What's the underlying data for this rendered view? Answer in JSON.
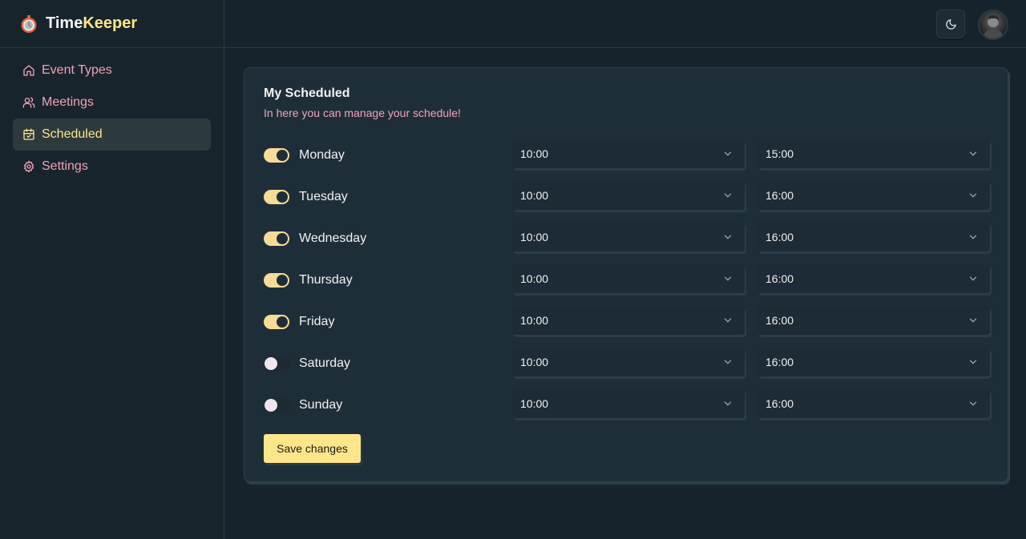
{
  "brand": {
    "name_part1": "Time",
    "name_part2": "Keeper",
    "logo_icon": "stopwatch-icon"
  },
  "nav": {
    "items": [
      {
        "label": "Event Types",
        "icon": "home-icon",
        "active": false
      },
      {
        "label": "Meetings",
        "icon": "users-icon",
        "active": false
      },
      {
        "label": "Scheduled",
        "icon": "calendar-check-icon",
        "active": true
      },
      {
        "label": "Settings",
        "icon": "gear-icon",
        "active": false
      }
    ]
  },
  "header": {
    "theme_icon": "moon-icon",
    "avatar_icon": "user-avatar"
  },
  "card": {
    "title": "My Scheduled",
    "subtitle": "In here you can manage your schedule!",
    "days": [
      {
        "name": "Monday",
        "enabled": true,
        "start": "10:00",
        "end": "15:00"
      },
      {
        "name": "Tuesday",
        "enabled": true,
        "start": "10:00",
        "end": "16:00"
      },
      {
        "name": "Wednesday",
        "enabled": true,
        "start": "10:00",
        "end": "16:00"
      },
      {
        "name": "Thursday",
        "enabled": true,
        "start": "10:00",
        "end": "16:00"
      },
      {
        "name": "Friday",
        "enabled": true,
        "start": "10:00",
        "end": "16:00"
      },
      {
        "name": "Saturday",
        "enabled": false,
        "start": "10:00",
        "end": "16:00"
      },
      {
        "name": "Sunday",
        "enabled": false,
        "start": "10:00",
        "end": "16:00"
      }
    ],
    "save_label": "Save changes"
  },
  "colors": {
    "accent": "#fde68a",
    "pink": "#f0a3b8",
    "background": "#17232c",
    "card": "#1e2e39"
  }
}
